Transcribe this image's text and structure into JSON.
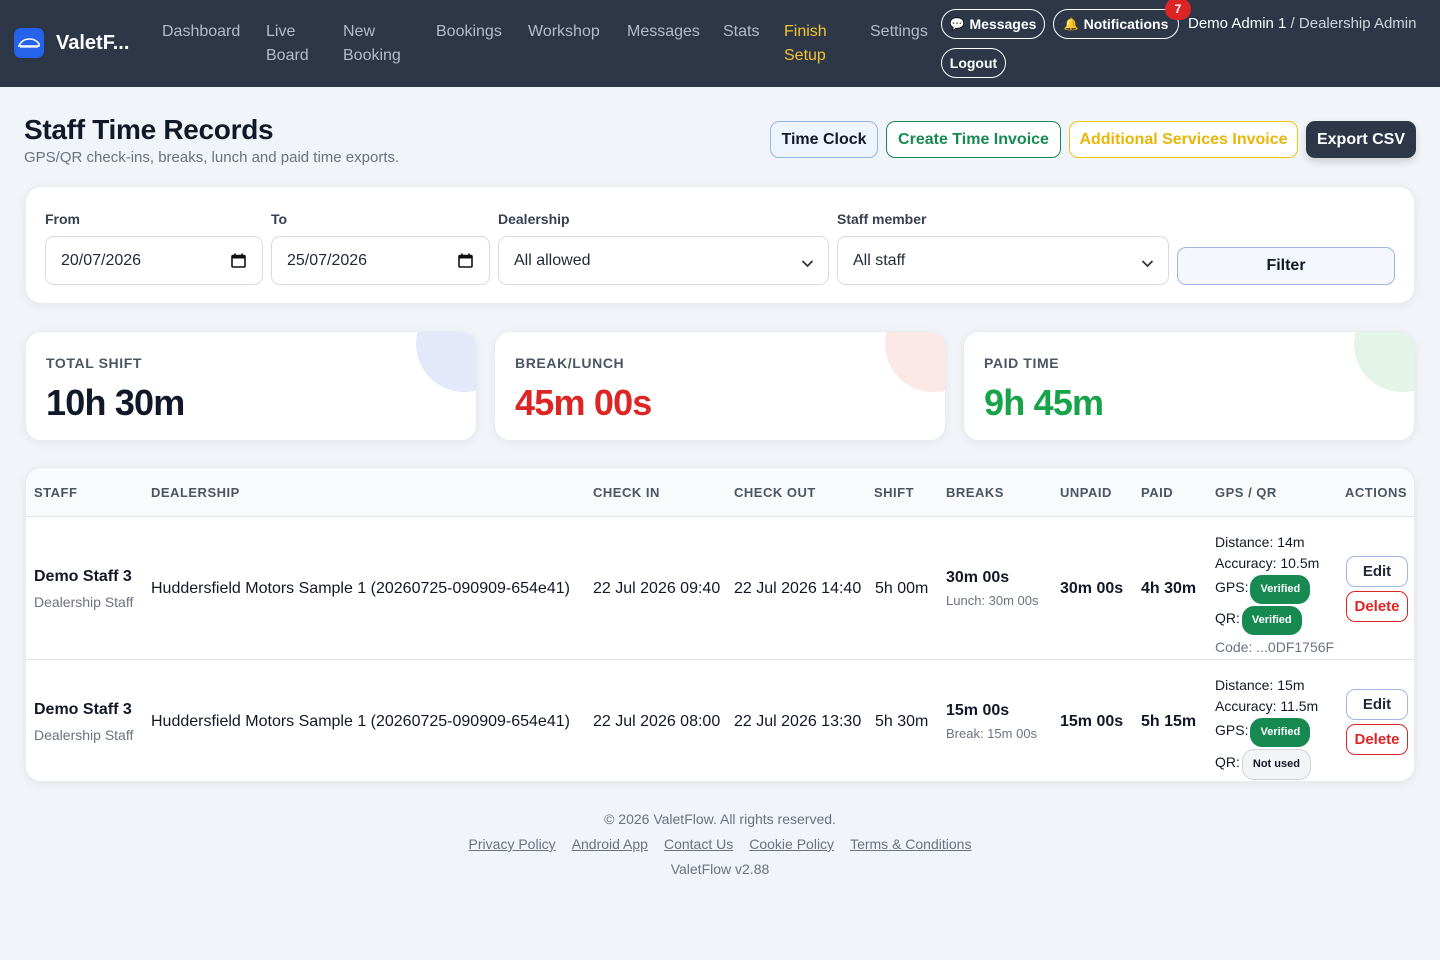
{
  "nav": {
    "brand": "ValetF...",
    "links": {
      "dashboard": "Dashboard",
      "live_board": "Live Board",
      "new_booking": "New Booking",
      "bookings": "Bookings",
      "workshop": "Workshop",
      "messages": "Messages",
      "stats": "Stats",
      "finish_setup": "Finish Setup",
      "settings": "Settings"
    },
    "messages_btn": "Messages",
    "notifications_btn": "Notifications",
    "notifications_count": "7",
    "logout_btn": "Logout",
    "user_name": "Demo Admin 1",
    "user_sep": " / ",
    "user_role": "Dealership Admin"
  },
  "header": {
    "title": "Staff Time Records",
    "subtitle": "GPS/QR check-ins, breaks, lunch and paid time exports.",
    "buttons": {
      "time_clock": "Time Clock",
      "create_invoice": "Create Time Invoice",
      "additional_invoice": "Additional Services Invoice",
      "export_csv": "Export CSV"
    }
  },
  "filters": {
    "from_label": "From",
    "from_value": "20/07/2026",
    "to_label": "To",
    "to_value": "25/07/2026",
    "dealership_label": "Dealership",
    "dealership_value": "All allowed",
    "staff_label": "Staff member",
    "staff_value": "All staff",
    "filter_btn": "Filter"
  },
  "stats": [
    {
      "label": "TOTAL SHIFT",
      "value": "10h 30m",
      "color": "#111827",
      "accent": "#e3e8fb"
    },
    {
      "label": "BREAK/LUNCH",
      "value": "45m 00s",
      "color": "#dc2626",
      "accent": "#fde8e8"
    },
    {
      "label": "PAID TIME",
      "value": "9h 45m",
      "color": "#16a34a",
      "accent": "#e3f4e9"
    }
  ],
  "table": {
    "columns": {
      "staff": "STAFF",
      "dealership": "DEALERSHIP",
      "check_in": "CHECK IN",
      "check_out": "CHECK OUT",
      "shift": "SHIFT",
      "breaks": "BREAKS",
      "unpaid": "UNPAID",
      "paid": "PAID",
      "gps_qr": "GPS / QR",
      "actions": "ACTIONS"
    },
    "rows": [
      {
        "staff": "Demo Staff 3",
        "role": "Dealership Staff",
        "dealership": "Huddersfield Motors Sample 1 (20260725-090909-654e41)",
        "check_in": "22 Jul 2026 09:40",
        "check_out": "22 Jul 2026 14:40",
        "shift": "5h 00m",
        "breaks": "30m 00s",
        "breaks_detail": "Lunch: 30m 00s",
        "unpaid": "30m 00s",
        "paid": "4h 30m",
        "distance": "Distance: 14m",
        "accuracy": "Accuracy: 10.5m",
        "gps_label": "GPS:",
        "gps_status": "Verified",
        "qr_label": "QR:",
        "qr_status": "Verified",
        "code": "Code: ...0DF1756F",
        "edit": "Edit",
        "delete": "Delete"
      },
      {
        "staff": "Demo Staff 3",
        "role": "Dealership Staff",
        "dealership": "Huddersfield Motors Sample 1 (20260725-090909-654e41)",
        "check_in": "22 Jul 2026 08:00",
        "check_out": "22 Jul 2026 13:30",
        "shift": "5h 30m",
        "breaks": "15m 00s",
        "breaks_detail": "Break: 15m 00s",
        "unpaid": "15m 00s",
        "paid": "5h 15m",
        "distance": "Distance: 15m",
        "accuracy": "Accuracy: 11.5m",
        "gps_label": "GPS:",
        "gps_status": "Verified",
        "qr_label": "QR:",
        "qr_status": "Not used",
        "edit": "Edit",
        "delete": "Delete"
      }
    ]
  },
  "footer": {
    "copyright": "© 2026 ValetFlow. All rights reserved.",
    "links": {
      "privacy": "Privacy Policy",
      "android": "Android App",
      "contact": "Contact Us",
      "cookie": "Cookie Policy",
      "terms": "Terms & Conditions"
    },
    "version": "ValetFlow v2.88"
  }
}
